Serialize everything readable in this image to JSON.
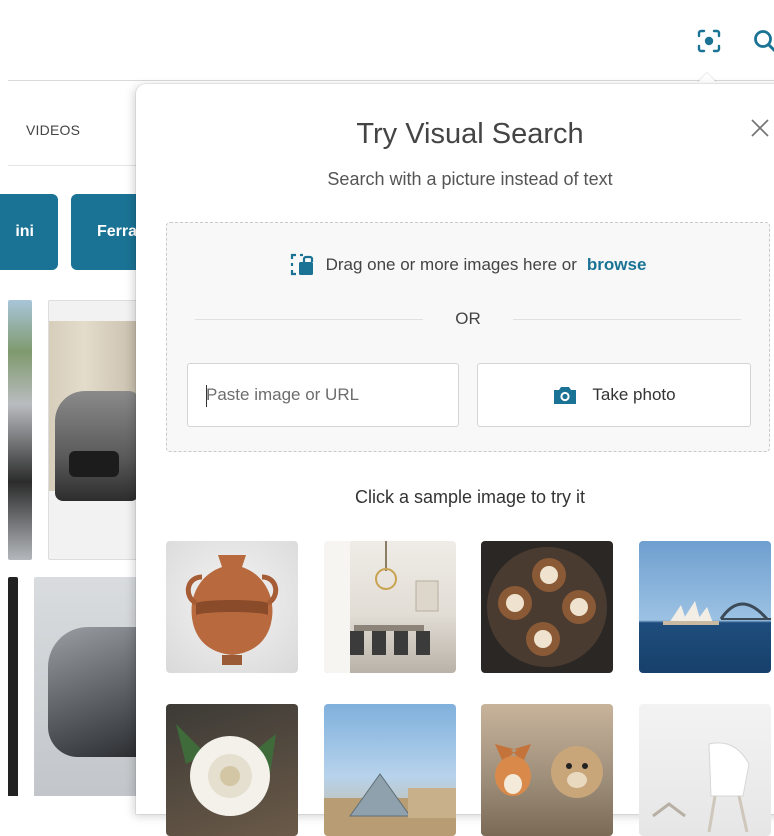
{
  "header": {
    "visual_search_icon": "visual-search-icon",
    "search_icon": "search-icon"
  },
  "background_page": {
    "tabs": [
      {
        "label": "VIDEOS"
      }
    ],
    "chips": [
      {
        "label": "ini"
      },
      {
        "label": "Ferra"
      }
    ]
  },
  "popup": {
    "title": "Try Visual Search",
    "subtitle": "Search with a picture instead of text",
    "close_icon": "close-icon",
    "dropzone": {
      "drag_text": "Drag one or more images here or",
      "browse_label": "browse",
      "or_label": "OR",
      "url_placeholder": "Paste image or URL",
      "take_photo_label": "Take photo"
    },
    "sample_caption": "Click a sample image to try it",
    "samples": [
      {
        "subject": "vase"
      },
      {
        "subject": "dining room"
      },
      {
        "subject": "latte art"
      },
      {
        "subject": "sydney opera house"
      },
      {
        "subject": "white rose"
      },
      {
        "subject": "louvre pyramid"
      },
      {
        "subject": "dogs"
      },
      {
        "subject": "white chair"
      }
    ]
  },
  "colors": {
    "accent": "#1a7394",
    "chip_background": "#1a7394"
  }
}
